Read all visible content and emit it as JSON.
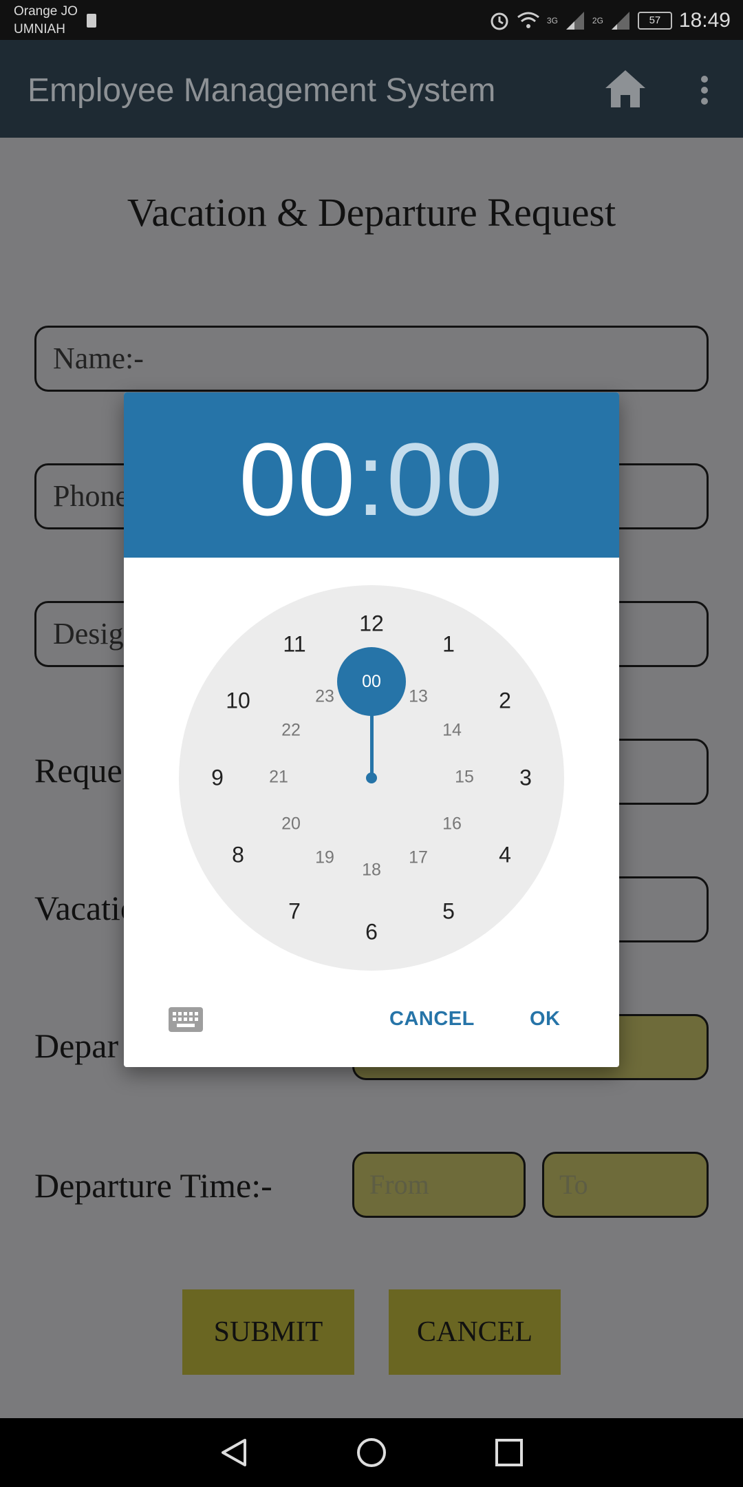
{
  "status": {
    "operator1": "Orange JO",
    "operator2": "UMNIAH",
    "net1": "3G",
    "net2": "2G",
    "battery": "57",
    "time": "18:49"
  },
  "appbar": {
    "title": "Employee Management System"
  },
  "page": {
    "heading": "Vacation & Departure Request",
    "name_field": "Name:-",
    "phone_field": "Phone",
    "designation_field": "Desig",
    "request_label": "Reque",
    "vacation_label": "Vacatio",
    "departure_label": "Depar",
    "departure_time_label": "Departure Time:-",
    "from_placeholder": "From",
    "to_placeholder": "To",
    "submit": "SUBMIT",
    "cancel": "CANCEL"
  },
  "dialog": {
    "hour": "00",
    "colon": ":",
    "minute": "00",
    "selected": "00",
    "outer": [
      "12",
      "1",
      "2",
      "3",
      "4",
      "5",
      "6",
      "7",
      "8",
      "9",
      "10",
      "11"
    ],
    "inner": [
      "13",
      "14",
      "15",
      "16",
      "17",
      "18",
      "19",
      "20",
      "21",
      "22",
      "23"
    ],
    "cancel": "CANCEL",
    "ok": "OK",
    "colors": {
      "accent": "#2674a8",
      "accent_light": "#c4dcec",
      "face": "#ececec"
    }
  }
}
